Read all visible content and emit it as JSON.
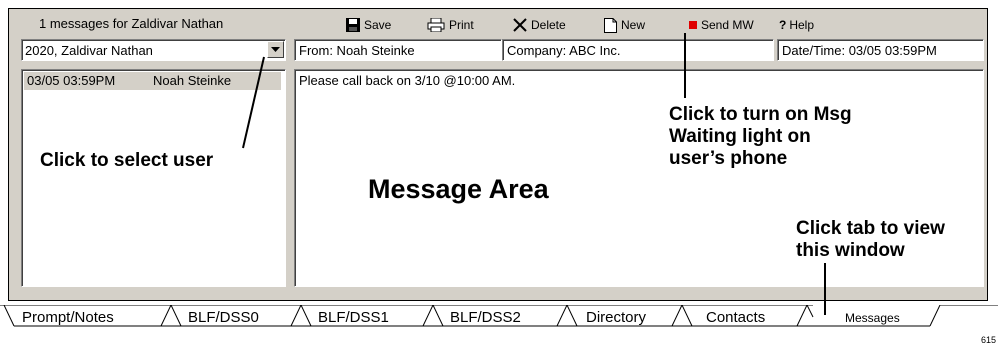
{
  "left_panel": {
    "header": "1 messages for Zaldivar Nathan",
    "user_select_value": "2020, Zaldivar Nathan",
    "messages": [
      {
        "time": "03/05 03:59PM",
        "from": "Noah Steinke"
      }
    ]
  },
  "toolbar": {
    "save_label": "Save",
    "print_label": "Print",
    "delete_label": "Delete",
    "new_label": "New",
    "send_mw_label": "Send MW",
    "help_label": "Help"
  },
  "message": {
    "from": "From: Noah Steinke",
    "company": "Company: ABC Inc.",
    "datetime": "Date/Time: 03/05 03:59PM",
    "body": "Please call back on 3/10 @10:00 AM."
  },
  "callouts": {
    "select_user": "Click to select user",
    "msg_waiting": [
      "Click to turn on Msg",
      "Waiting light on",
      "user’s phone"
    ],
    "message_area": "Message Area",
    "tab_view": [
      "Click tab to view",
      "this window"
    ]
  },
  "tabs": [
    "Prompt/Notes",
    "BLF/DSS0",
    "BLF/DSS1",
    "BLF/DSS2",
    "Directory",
    "Contacts",
    "Messages"
  ],
  "active_tab": "Messages",
  "figure_number": "615",
  "colors": {
    "send_mw_indicator": "#e00000",
    "panel_bg": "#d4d0c8"
  }
}
